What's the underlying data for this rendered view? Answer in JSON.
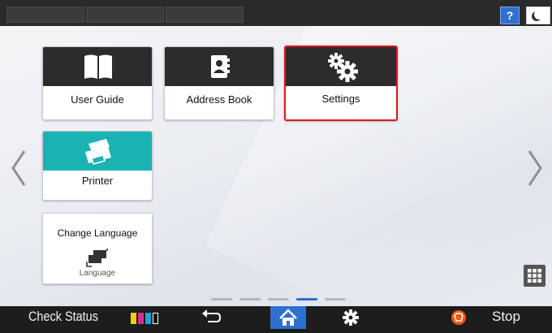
{
  "topbar": {
    "help_label": "?",
    "moon_icon": "moon-icon"
  },
  "apps": [
    {
      "label": "User Guide",
      "icon": "book-icon"
    },
    {
      "label": "Address Book",
      "icon": "address-book-icon"
    },
    {
      "label": "Settings",
      "icon": "gears-icon",
      "selected": true
    },
    {
      "label": "Printer",
      "icon": "printer-icon",
      "band_color": "#1ab3b3"
    },
    {
      "label": "Change Language",
      "sublabel": "Language",
      "icon": "language-icon"
    }
  ],
  "pagination": {
    "pages": 5,
    "current": 4
  },
  "bottombar": {
    "check_status": "Check Status",
    "stop": "Stop",
    "toner_colors": [
      "#f5d000",
      "#d42f8e",
      "#1aa6df",
      "#111111"
    ]
  },
  "colors": {
    "accent": "#2f6fd0",
    "selected_border": "#e01818",
    "stop": "#e85a17"
  }
}
